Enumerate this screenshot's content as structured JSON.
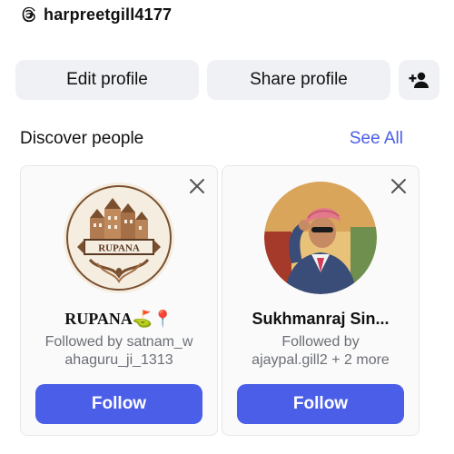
{
  "header": {
    "username": "harpreetgill4177",
    "threads_icon": "threads-icon"
  },
  "actions": {
    "edit_profile_label": "Edit profile",
    "share_profile_label": "Share profile",
    "add_friend_icon": "add-person-icon"
  },
  "discover": {
    "title": "Discover people",
    "see_all_label": "See All",
    "cards": [
      {
        "name": "RUPANA⛳📍",
        "followed_by_line1": "Followed by satnam_w",
        "followed_by_line2": "ahaguru_ji_1313",
        "follow_label": "Follow",
        "avatar_text": "RUPANA"
      },
      {
        "name": "Sukhmanraj Sin...",
        "followed_by_line1": "Followed by",
        "followed_by_line2": "ajaypal.gill2 + 2 more",
        "follow_label": "Follow"
      }
    ]
  },
  "colors": {
    "accent": "#4a5ee8",
    "pill_bg": "#eff1f4",
    "muted_text": "#6b6f76"
  }
}
